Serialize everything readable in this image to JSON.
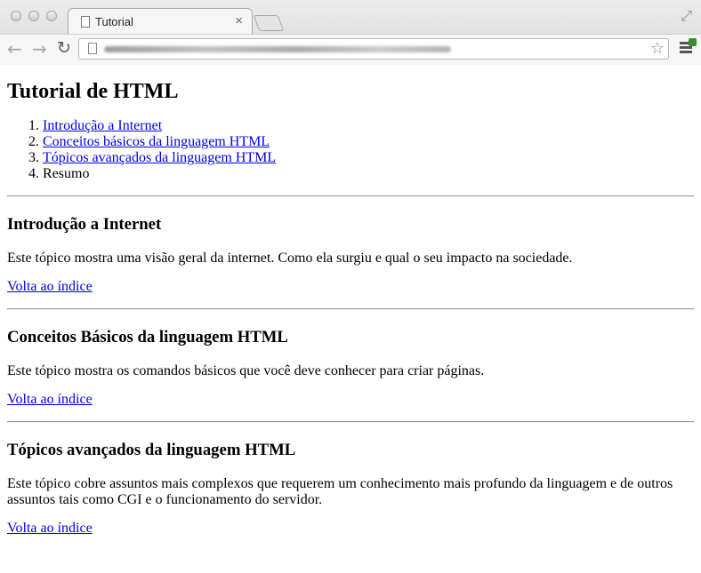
{
  "browser": {
    "tab_title": "Tutorial",
    "tab_close": "×"
  },
  "page": {
    "title": "Tutorial de HTML",
    "toc": [
      {
        "label": "Introdução a Internet",
        "link": true
      },
      {
        "label": "Conceitos básicos da linguagem HTML",
        "link": true
      },
      {
        "label": "Tópicos avançados da linguagem HTML",
        "link": true
      },
      {
        "label": "Resumo",
        "link": false
      }
    ],
    "sections": [
      {
        "heading": "Introdução a Internet",
        "text": "Este tópico mostra uma visão geral da internet. Como ela surgiu e qual o seu impacto na sociedade.",
        "back_link": "Volta ao índice"
      },
      {
        "heading": "Conceitos Básicos da linguagem HTML",
        "text": "Este tópico mostra os comandos básicos que você deve conhecer para criar páginas.",
        "back_link": "Volta ao índice"
      },
      {
        "heading": "Tópicos avançados da linguagem HTML",
        "text": "Este tópico cobre assuntos mais complexos que requerem um conhecimento mais profundo da linguagem e de outros assuntos tais como CGI e o funcionamento do servidor.",
        "back_link": "Volta ao índice"
      }
    ]
  }
}
